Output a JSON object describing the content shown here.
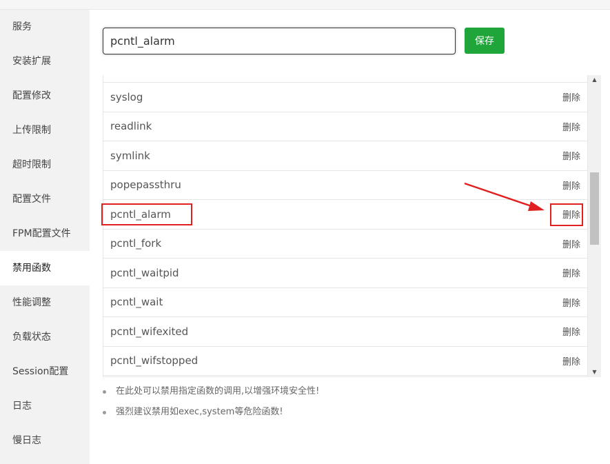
{
  "sidebar": {
    "items": [
      {
        "label": "服务"
      },
      {
        "label": "安装扩展"
      },
      {
        "label": "配置修改"
      },
      {
        "label": "上传限制"
      },
      {
        "label": "超时限制"
      },
      {
        "label": "配置文件"
      },
      {
        "label": "FPM配置文件"
      },
      {
        "label": "禁用函数",
        "active": true
      },
      {
        "label": "性能调整"
      },
      {
        "label": "负载状态"
      },
      {
        "label": "Session配置"
      },
      {
        "label": "日志"
      },
      {
        "label": "慢日志"
      }
    ]
  },
  "toolbar": {
    "input_value": "pcntl_alarm",
    "save_label": "保存"
  },
  "functions": {
    "delete_label": "删除",
    "rows": [
      {
        "name": "syslog"
      },
      {
        "name": "readlink"
      },
      {
        "name": "symlink"
      },
      {
        "name": "popepassthru"
      },
      {
        "name": "pcntl_alarm"
      },
      {
        "name": "pcntl_fork"
      },
      {
        "name": "pcntl_waitpid"
      },
      {
        "name": "pcntl_wait"
      },
      {
        "name": "pcntl_wifexited"
      },
      {
        "name": "pcntl_wifstopped"
      }
    ]
  },
  "tips": [
    "在此处可以禁用指定函数的调用,以增强环境安全性!",
    "强烈建议禁用如exec,system等危险函数!"
  ],
  "annotations": {
    "highlight_color": "#e02020"
  },
  "colors": {
    "accent": "#20a53a",
    "sidebar_bg": "#f2f2f2"
  }
}
